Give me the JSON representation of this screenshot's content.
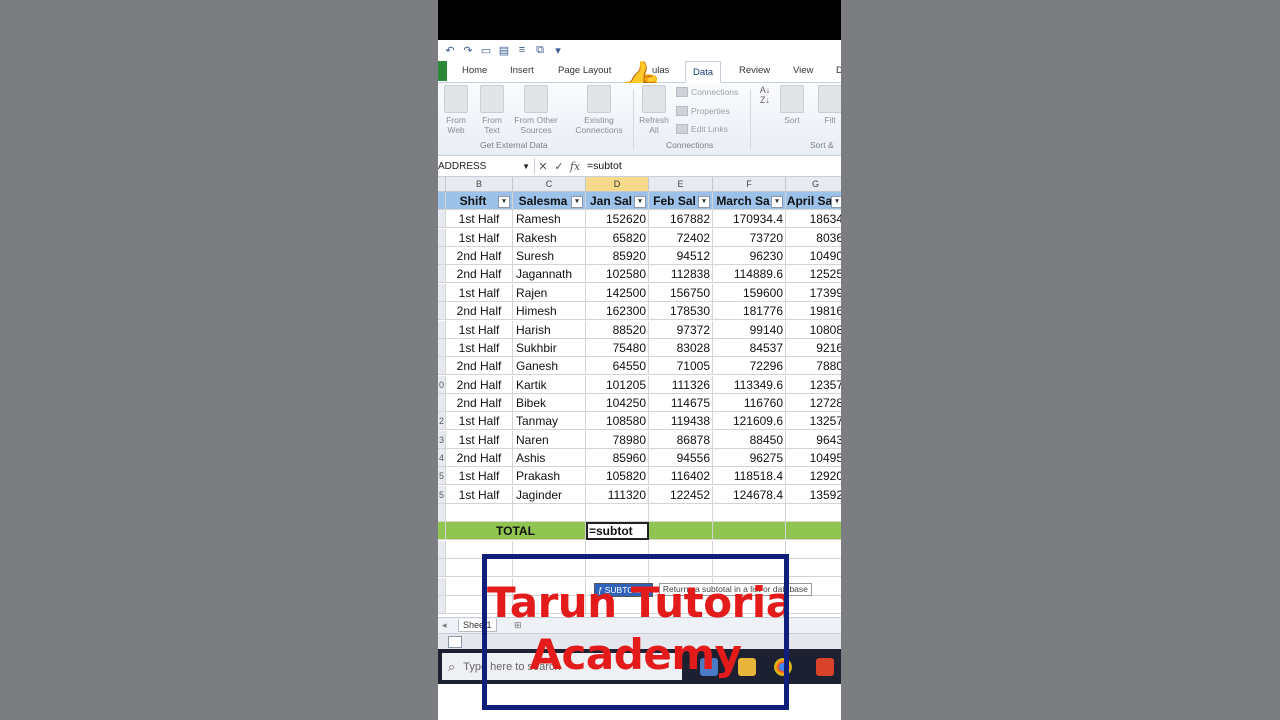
{
  "ribbon": {
    "tabs": [
      "Home",
      "Insert",
      "Page Layout",
      "ulas",
      "Data",
      "Review",
      "View",
      "D"
    ],
    "active_tab": "Data",
    "get_external": {
      "buttons": [
        "From\nWeb",
        "From\nText",
        "From Other\nSources",
        "Existing\nConnections"
      ],
      "label": "Get External Data"
    },
    "connections": {
      "refresh": "Refresh\nAll",
      "items": [
        "Connections",
        "Properties",
        "Edit Links"
      ],
      "label": "Connections"
    },
    "sort": {
      "sort_label": "Sort",
      "filter_label": "Filt",
      "group_label": "Sort &"
    }
  },
  "formula_bar": {
    "name_box": "ADDRESS",
    "fx": "fx",
    "formula": "=subtot"
  },
  "columns": [
    "B",
    "C",
    "D",
    "E",
    "F",
    "G"
  ],
  "table": {
    "headers": [
      "Shift",
      "Salesma",
      "Jan Sal",
      "Feb Sal",
      "March Sa",
      "April Sa"
    ],
    "rows": [
      {
        "n": "",
        "shift": "1st Half",
        "name": "Ramesh",
        "jan": "152620",
        "feb": "167882",
        "mar": "170934.4",
        "apr": "18634"
      },
      {
        "n": "",
        "shift": "1st Half",
        "name": "Rakesh",
        "jan": "65820",
        "feb": "72402",
        "mar": "73720",
        "apr": "8036"
      },
      {
        "n": "",
        "shift": "2nd Half",
        "name": "Suresh",
        "jan": "85920",
        "feb": "94512",
        "mar": "96230",
        "apr": "10490"
      },
      {
        "n": "",
        "shift": "2nd Half",
        "name": "Jagannath",
        "jan": "102580",
        "feb": "112838",
        "mar": "114889.6",
        "apr": "12525"
      },
      {
        "n": "",
        "shift": "1st Half",
        "name": "Rajen",
        "jan": "142500",
        "feb": "156750",
        "mar": "159600",
        "apr": "17399"
      },
      {
        "n": "",
        "shift": "2nd Half",
        "name": "Himesh",
        "jan": "162300",
        "feb": "178530",
        "mar": "181776",
        "apr": "19816"
      },
      {
        "n": "",
        "shift": "1st Half",
        "name": "Harish",
        "jan": "88520",
        "feb": "97372",
        "mar": "99140",
        "apr": "10808"
      },
      {
        "n": "",
        "shift": "1st Half",
        "name": "Sukhbir",
        "jan": "75480",
        "feb": "83028",
        "mar": "84537",
        "apr": "9216"
      },
      {
        "n": "",
        "shift": "2nd Half",
        "name": "Ganesh",
        "jan": "64550",
        "feb": "71005",
        "mar": "72296",
        "apr": "7880"
      },
      {
        "n": "0",
        "shift": "2nd Half",
        "name": "Kartik",
        "jan": "101205",
        "feb": "111326",
        "mar": "113349.6",
        "apr": "12357"
      },
      {
        "n": "",
        "shift": "2nd Half",
        "name": "Bibek",
        "jan": "104250",
        "feb": "114675",
        "mar": "116760",
        "apr": "12728"
      },
      {
        "n": "2",
        "shift": "1st Half",
        "name": "Tanmay",
        "jan": "108580",
        "feb": "119438",
        "mar": "121609.6",
        "apr": "13257"
      },
      {
        "n": "3",
        "shift": "1st Half",
        "name": "Naren",
        "jan": "78980",
        "feb": "86878",
        "mar": "88450",
        "apr": "9643"
      },
      {
        "n": "4",
        "shift": "2nd Half",
        "name": "Ashis",
        "jan": "85960",
        "feb": "94556",
        "mar": "96275",
        "apr": "10495"
      },
      {
        "n": "5",
        "shift": "1st Half",
        "name": "Prakash",
        "jan": "105820",
        "feb": "116402",
        "mar": "118518.4",
        "apr": "12920"
      },
      {
        "n": "5",
        "shift": "1st Half",
        "name": "Jaginder",
        "jan": "111320",
        "feb": "122452",
        "mar": "124678.4",
        "apr": "13592"
      }
    ],
    "total_label": "TOTAL",
    "total_entry": "=subtot"
  },
  "autocomplete": {
    "item": "SUBTOTAL",
    "tooltip": "Returns a subtotal in a list or database"
  },
  "sheet_tab": "Sheet1",
  "taskbar": {
    "search_placeholder": "Type here to search"
  },
  "watermark": {
    "line1": "Tarun Tutoria",
    "line2": "Academy"
  },
  "colors": {
    "table_header": "#9cc2ea",
    "total_row": "#8fc550",
    "watermark_text": "#e31b1b",
    "watermark_border": "#101f7a"
  }
}
